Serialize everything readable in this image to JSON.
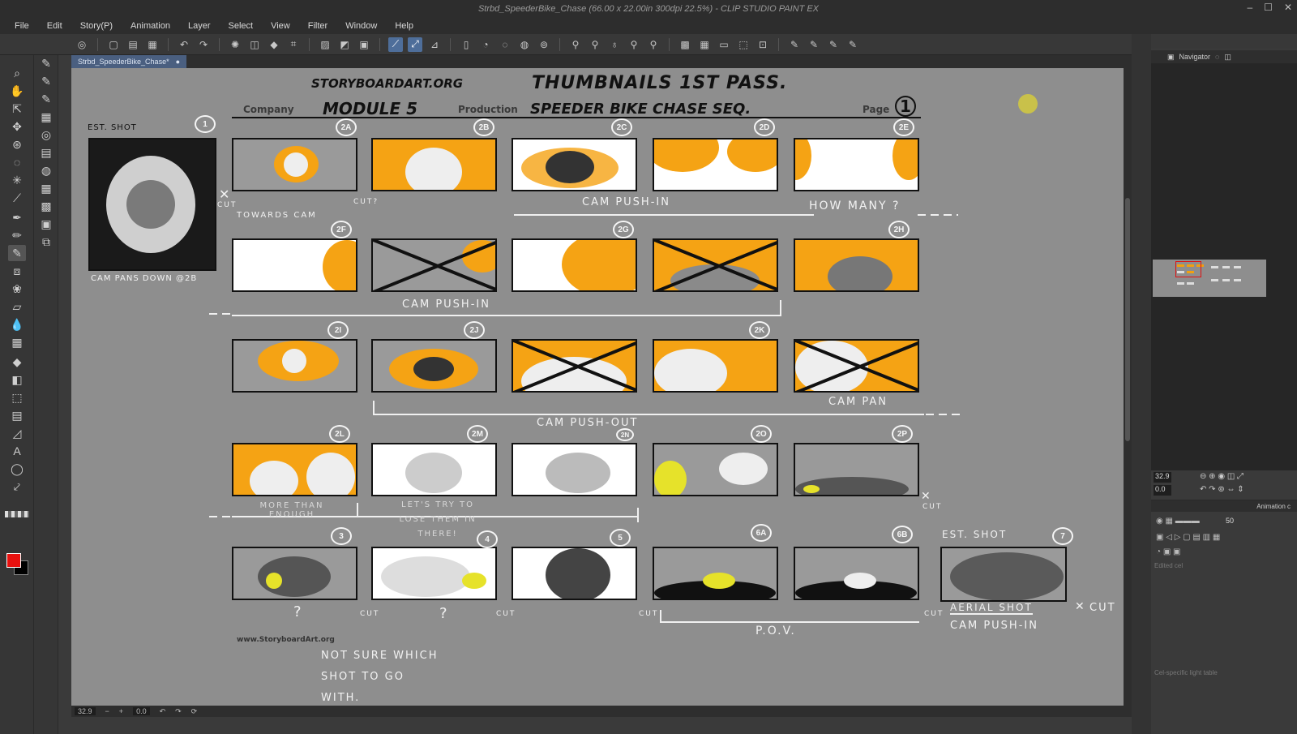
{
  "window": {
    "title": "Strbd_SpeederBike_Chase (66.00 x 22.00in 300dpi 22.5%)  - CLIP STUDIO PAINT EX"
  },
  "menu": [
    "File",
    "Edit",
    "Story(P)",
    "Animation",
    "Layer",
    "Select",
    "View",
    "Filter",
    "Window",
    "Help"
  ],
  "document_tab": {
    "label": "Strbd_SpeederBike_Chase*",
    "close": "●"
  },
  "status": {
    "zoom": "32.9",
    "angle": "0.0"
  },
  "navigator": {
    "tab": "Navigator",
    "zoom": "32.9",
    "angle": "0.0"
  },
  "animation": {
    "tab": "Animation c",
    "opacity": "50",
    "edited_cel": "Edited cel",
    "light_table": "Cel-specific light table"
  },
  "colors": {
    "main": "#e8110f",
    "sub": "#000000",
    "accent": "#f5a314"
  },
  "storyboard": {
    "site_header": "STORYBOARDART.ORG",
    "title": "THUMBNAILS 1ST PASS.",
    "company_label": "Company",
    "company_value": "MODULE 5",
    "production_label": "Production",
    "production_value": "SPEEDER BIKE CHASE SEQ.",
    "page_label": "Page",
    "page_value": "1",
    "est_shot": "EST. SHOT",
    "est_num": "1",
    "cam_pans_down": "CAM PANS DOWN @2B",
    "towards_cam": "TOWARDS CAM",
    "cut": "CUT",
    "cut_q": "CUT?",
    "cam_push_in": "CAM PUSH-IN",
    "how_many": "HOW MANY ?",
    "cam_push_in_2": "CAM PUSH-IN",
    "cam_pan": "CAM PAN",
    "cam_push_out": "CAM PUSH-OUT",
    "more_than_enough": "MORE THAN ENOUGH",
    "lets_try": "LET'S TRY TO LOSE THEM IN THERE!",
    "q1": "?",
    "q2": "?",
    "pov": "P.O.V.",
    "est_shot_2": "EST. SHOT",
    "aerial_shot": "AERIAL SHOT",
    "cam_push_in_3": "CAM PUSH-IN",
    "not_sure": "NOT SURE WHICH SHOT TO GO WITH.",
    "footer_url": "www.StoryboardArt.org",
    "panel_numbers": [
      "2A",
      "2B",
      "2C",
      "2D",
      "2E",
      "2F",
      "2G",
      "2H",
      "2I",
      "2J",
      "2K",
      "2L",
      "2M",
      "2N",
      "2O",
      "2P",
      "3",
      "4",
      "5",
      "6A",
      "6B",
      "7"
    ]
  }
}
